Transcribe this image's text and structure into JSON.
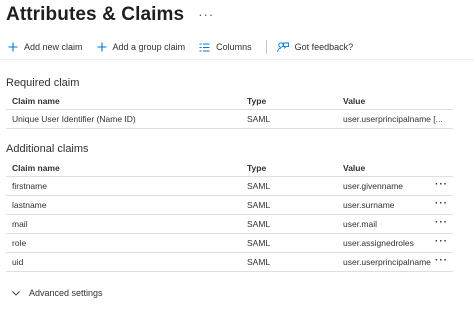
{
  "header": {
    "title": "Attributes & Claims",
    "more": "···"
  },
  "toolbar": {
    "add_new_claim": "Add new claim",
    "add_group_claim": "Add a group claim",
    "columns": "Columns",
    "feedback": "Got feedback?"
  },
  "required": {
    "section_title": "Required claim",
    "columns": [
      "Claim name",
      "Type",
      "Value"
    ],
    "rows": [
      {
        "name": "Unique User Identifier (Name ID)",
        "type": "SAML",
        "value": "user.userprincipalname [..."
      }
    ]
  },
  "additional": {
    "section_title": "Additional claims",
    "columns": [
      "Claim name",
      "Type",
      "Value"
    ],
    "row_more": "···",
    "rows": [
      {
        "name": "firstname",
        "type": "SAML",
        "value": "user.givenname"
      },
      {
        "name": "lastname",
        "type": "SAML",
        "value": "user.surname"
      },
      {
        "name": "mail",
        "type": "SAML",
        "value": "user.mail"
      },
      {
        "name": "role",
        "type": "SAML",
        "value": "user.assignedroles"
      },
      {
        "name": "uid",
        "type": "SAML",
        "value": "user.userprincipalname"
      }
    ]
  },
  "advanced": {
    "label": "Advanced settings"
  },
  "colors": {
    "accent": "#0078d4",
    "divider": "#e1dfdd",
    "text": "#323130"
  }
}
